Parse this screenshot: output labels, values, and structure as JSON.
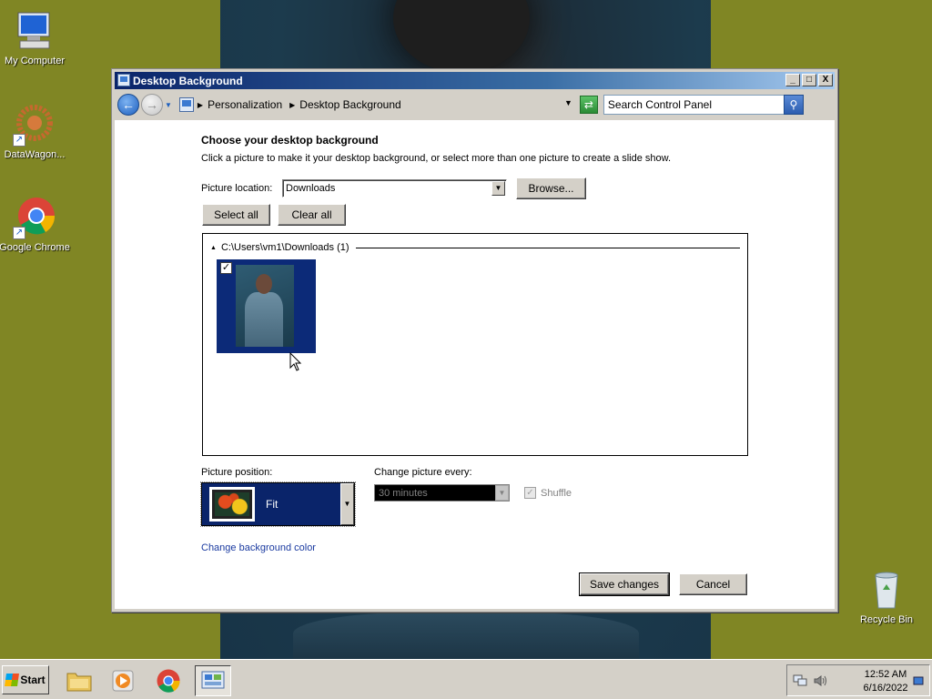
{
  "desktop": {
    "icons": [
      {
        "label": "My Computer",
        "icon": "computer-icon"
      },
      {
        "label": "DataWagon...",
        "icon": "datawagon-icon"
      },
      {
        "label": "Google Chrome",
        "icon": "chrome-icon"
      },
      {
        "label": "Recycle Bin",
        "icon": "recycle-bin-icon"
      }
    ]
  },
  "window": {
    "title": "Desktop Background",
    "controls": {
      "minimize": "_",
      "maximize": "□",
      "close": "X"
    },
    "breadcrumb": [
      "Personalization",
      "Desktop Background"
    ],
    "search_placeholder": "Search Control Panel"
  },
  "content": {
    "heading": "Choose your desktop background",
    "subtext": "Click a picture to make it your desktop background, or select more than one picture to create a slide show.",
    "picture_location_label": "Picture location:",
    "picture_location_value": "Downloads",
    "browse_label": "Browse...",
    "select_all_label": "Select all",
    "clear_all_label": "Clear all",
    "gallery_group": "C:\\Users\\vm1\\Downloads (1)",
    "thumbnail_checked": true,
    "picture_position_label": "Picture position:",
    "picture_position_value": "Fit",
    "change_every_label": "Change picture every:",
    "change_every_value": "30 minutes",
    "shuffle_label": "Shuffle",
    "shuffle_checked": true,
    "change_color_link": "Change background color",
    "save_label": "Save changes",
    "cancel_label": "Cancel"
  },
  "taskbar": {
    "start_label": "Start",
    "clock_time": "12:52 AM",
    "clock_date": "6/16/2022"
  },
  "colors": {
    "desktop": "#808624",
    "title_bar": "#0a246a",
    "selection": "#0a246a",
    "link": "#1a3aa0"
  }
}
